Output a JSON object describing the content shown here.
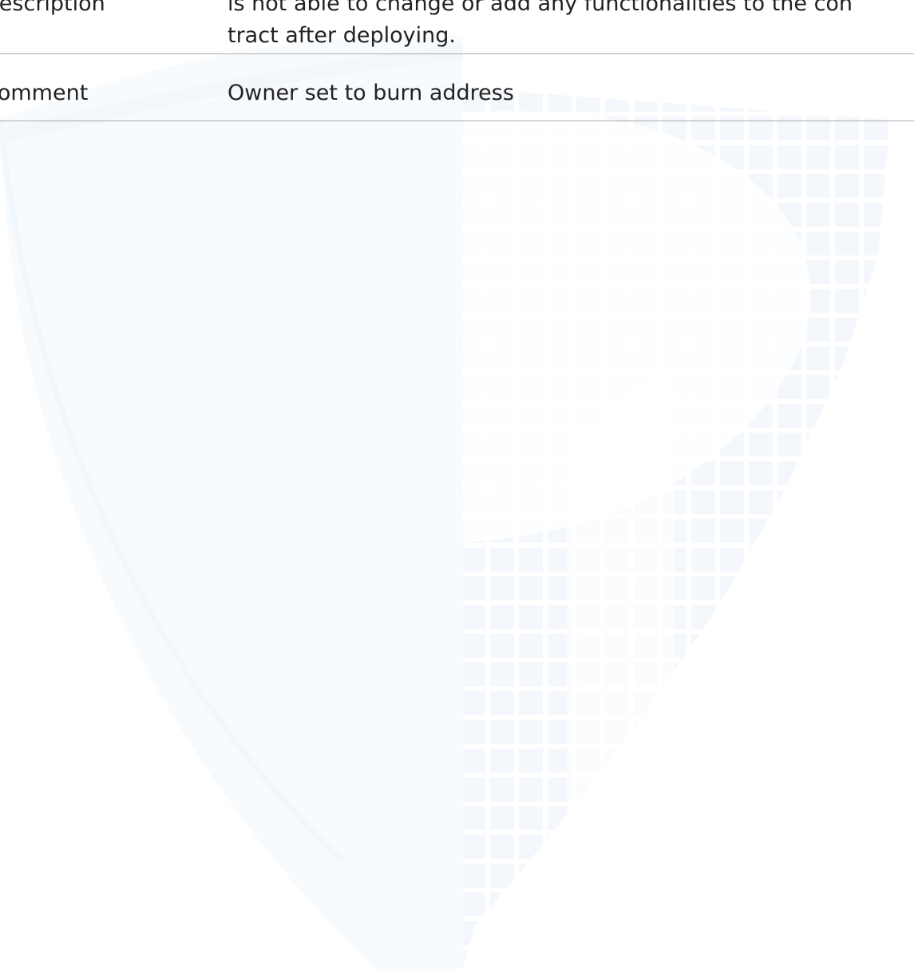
{
  "table": {
    "rows": [
      {
        "label": "Description",
        "value_lines": [
          "is not able to change or add any functionalities to the con",
          "tract after deploying."
        ]
      },
      {
        "label": "Comment",
        "value_lines": [
          "Owner set to burn address"
        ]
      }
    ]
  },
  "colors": {
    "text": "#222222",
    "rule": "#a9a9a9",
    "watermark": "#f3f8fc"
  },
  "icons": {
    "watermark": "shield-logo-watermark-icon"
  }
}
